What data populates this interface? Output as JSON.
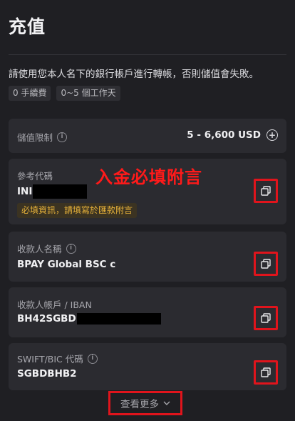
{
  "page": {
    "title": "充值"
  },
  "notice": "請使用您本人名下的銀行帳戶進行轉帳，否則儲值會失敗。",
  "chips": [
    "0 手續費",
    "0~5 個工作天"
  ],
  "limit_card": {
    "label": "儲值限制",
    "range": "5 - 6,600 USD"
  },
  "reference_card": {
    "label": "參考代碼",
    "value_prefix": "INI",
    "warning": "必填資訊，請填寫於匯款附言"
  },
  "annotation": "入金必填附言",
  "payee_card": {
    "label": "收款人名稱",
    "value": "BPAY Global BSC c"
  },
  "account_card": {
    "label": "收款人帳戶 / IBAN",
    "value_prefix": "BH42SGBD"
  },
  "swift_card": {
    "label": "SWIFT/BIC 代碼",
    "value": "SGBDBHB2"
  },
  "more_button": {
    "label": "查看更多"
  },
  "colors": {
    "background": "#1f1f23",
    "card": "#2b2b30",
    "highlight_border": "#e0141c",
    "warning_text": "#e8b33a"
  }
}
